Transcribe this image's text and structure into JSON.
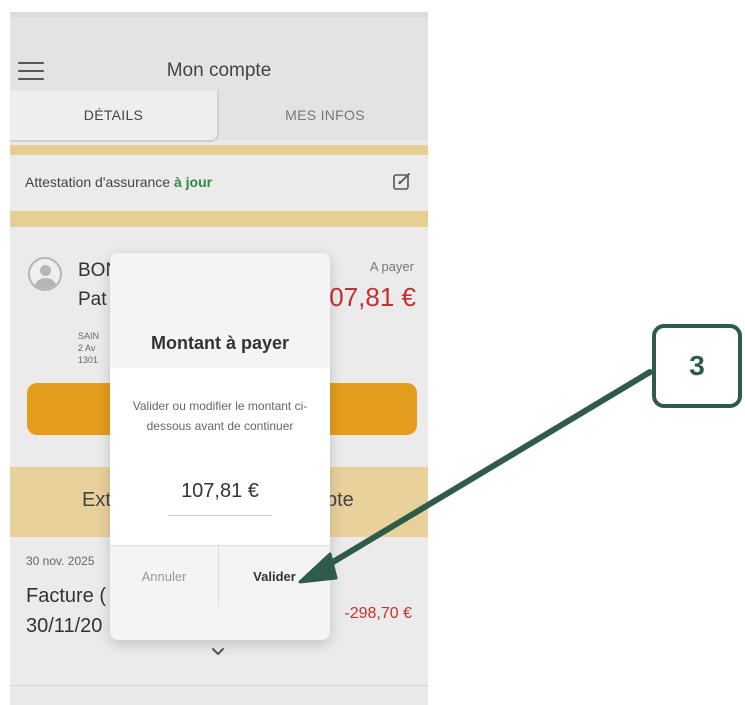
{
  "header": {
    "title": "Mon compte",
    "menu_icon": "hamburger-menu-icon"
  },
  "tabs": [
    {
      "label": "DÉTAILS",
      "active": true
    },
    {
      "label": "MES INFOS",
      "active": false
    }
  ],
  "insurance": {
    "label": "Attestation d'assurance ",
    "status": "à jour",
    "edit_icon": "edit-icon"
  },
  "account": {
    "name_line1": "BON",
    "name_line2": "Pat",
    "address_lines": [
      "SAIN",
      "2 Av",
      "1301"
    ],
    "due_label": "A payer",
    "due_amount": "07,81 €",
    "pay_button_label": ""
  },
  "extract": {
    "left_text": "Ext",
    "right_text": "pte"
  },
  "transactions": [
    {
      "date": "30 nov. 2025",
      "label_line1": "Facture (",
      "label_line2": "30/11/20",
      "amount": "-298,70 €"
    }
  ],
  "dialog": {
    "title": "Montant à payer",
    "message": "Valider ou modifier le montant ci-dessous avant de continuer",
    "amount": "107,81 €",
    "cancel_label": "Annuler",
    "confirm_label": "Valider"
  },
  "annotation": {
    "number": "3",
    "color": "#2f5b4b"
  },
  "colors": {
    "accent": "#e59e1b",
    "band": "#e6cf92",
    "negative": "#c62f2f",
    "status_ok": "#2e8a3e"
  }
}
